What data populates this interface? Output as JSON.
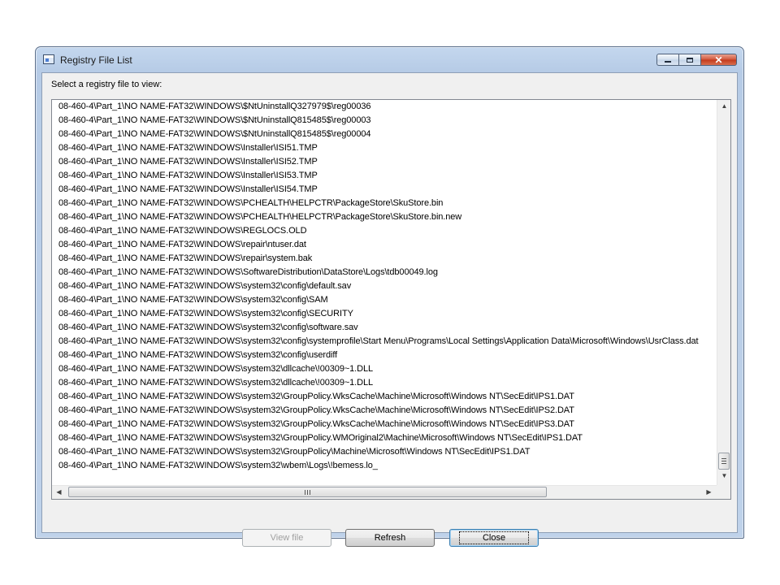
{
  "window": {
    "title": "Registry File List",
    "minimize_glyph": "",
    "maximize_glyph": "",
    "close_glyph": "✕"
  },
  "prompt": "Select a registry file to view:",
  "files": [
    "08-460-4\\Part_1\\NO NAME-FAT32\\WINDOWS\\$NtUninstallQ327979$\\reg00036",
    "08-460-4\\Part_1\\NO NAME-FAT32\\WINDOWS\\$NtUninstallQ815485$\\reg00003",
    "08-460-4\\Part_1\\NO NAME-FAT32\\WINDOWS\\$NtUninstallQ815485$\\reg00004",
    "08-460-4\\Part_1\\NO NAME-FAT32\\WINDOWS\\Installer\\ISI51.TMP",
    "08-460-4\\Part_1\\NO NAME-FAT32\\WINDOWS\\Installer\\ISI52.TMP",
    "08-460-4\\Part_1\\NO NAME-FAT32\\WINDOWS\\Installer\\ISI53.TMP",
    "08-460-4\\Part_1\\NO NAME-FAT32\\WINDOWS\\Installer\\ISI54.TMP",
    "08-460-4\\Part_1\\NO NAME-FAT32\\WINDOWS\\PCHEALTH\\HELPCTR\\PackageStore\\SkuStore.bin",
    "08-460-4\\Part_1\\NO NAME-FAT32\\WINDOWS\\PCHEALTH\\HELPCTR\\PackageStore\\SkuStore.bin.new",
    "08-460-4\\Part_1\\NO NAME-FAT32\\WINDOWS\\REGLOCS.OLD",
    "08-460-4\\Part_1\\NO NAME-FAT32\\WINDOWS\\repair\\ntuser.dat",
    "08-460-4\\Part_1\\NO NAME-FAT32\\WINDOWS\\repair\\system.bak",
    "08-460-4\\Part_1\\NO NAME-FAT32\\WINDOWS\\SoftwareDistribution\\DataStore\\Logs\\tdb00049.log",
    "08-460-4\\Part_1\\NO NAME-FAT32\\WINDOWS\\system32\\config\\default.sav",
    "08-460-4\\Part_1\\NO NAME-FAT32\\WINDOWS\\system32\\config\\SAM",
    "08-460-4\\Part_1\\NO NAME-FAT32\\WINDOWS\\system32\\config\\SECURITY",
    "08-460-4\\Part_1\\NO NAME-FAT32\\WINDOWS\\system32\\config\\software.sav",
    "08-460-4\\Part_1\\NO NAME-FAT32\\WINDOWS\\system32\\config\\systemprofile\\Start Menu\\Programs\\Local Settings\\Application Data\\Microsoft\\Windows\\UsrClass.dat",
    "08-460-4\\Part_1\\NO NAME-FAT32\\WINDOWS\\system32\\config\\userdiff",
    "08-460-4\\Part_1\\NO NAME-FAT32\\WINDOWS\\system32\\dllcache\\!00309~1.DLL",
    "08-460-4\\Part_1\\NO NAME-FAT32\\WINDOWS\\system32\\dllcache\\!00309~1.DLL",
    "08-460-4\\Part_1\\NO NAME-FAT32\\WINDOWS\\system32\\GroupPolicy.WksCache\\Machine\\Microsoft\\Windows NT\\SecEdit\\IPS1.DAT",
    "08-460-4\\Part_1\\NO NAME-FAT32\\WINDOWS\\system32\\GroupPolicy.WksCache\\Machine\\Microsoft\\Windows NT\\SecEdit\\IPS2.DAT",
    "08-460-4\\Part_1\\NO NAME-FAT32\\WINDOWS\\system32\\GroupPolicy.WksCache\\Machine\\Microsoft\\Windows NT\\SecEdit\\IPS3.DAT",
    "08-460-4\\Part_1\\NO NAME-FAT32\\WINDOWS\\system32\\GroupPolicy.WMOriginal2\\Machine\\Microsoft\\Windows NT\\SecEdit\\IPS1.DAT",
    "08-460-4\\Part_1\\NO NAME-FAT32\\WINDOWS\\system32\\GroupPolicy\\Machine\\Microsoft\\Windows NT\\SecEdit\\IPS1.DAT",
    "08-460-4\\Part_1\\NO NAME-FAT32\\WINDOWS\\system32\\wbem\\Logs\\!bemess.lo_"
  ],
  "scrollbars": {
    "up_arrow": "▲",
    "down_arrow": "▼",
    "left_arrow": "◀",
    "right_arrow": "▶"
  },
  "buttons": {
    "view_file": "View file",
    "refresh": "Refresh",
    "close": "Close"
  },
  "colors": {
    "window_frame": "#bfd2ea",
    "client_bg": "#f0f0f0",
    "close_button": "#c2391b",
    "default_button_border": "#3c7fb1"
  },
  "icons": [
    "app-window-icon",
    "minimize-icon",
    "maximize-icon",
    "close-icon"
  ]
}
